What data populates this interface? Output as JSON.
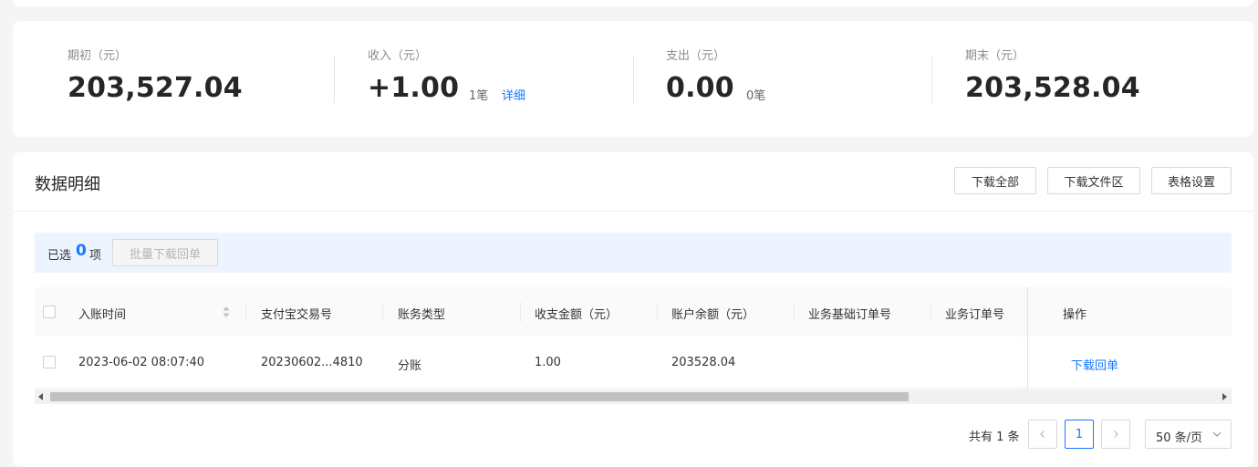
{
  "summary": {
    "opening": {
      "label": "期初（元）",
      "value": "203,527.04"
    },
    "income": {
      "label": "收入（元）",
      "value": "+1.00",
      "count": "1笔",
      "detail_link": "详细"
    },
    "expense": {
      "label": "支出（元）",
      "value": "0.00",
      "count": "0笔"
    },
    "closing": {
      "label": "期末（元）",
      "value": "203,528.04"
    }
  },
  "detail": {
    "title": "数据明细",
    "buttons": {
      "download_all": "下载全部",
      "download_area": "下载文件区",
      "table_settings": "表格设置"
    },
    "selection": {
      "prefix": "已选",
      "count": "0",
      "suffix": "项",
      "bulk_button": "批量下载回单"
    },
    "columns": [
      "入账时间",
      "支付宝交易号",
      "账务类型",
      "收支金额（元）",
      "账户余额（元）",
      "业务基础订单号",
      "业务订单号",
      "操作"
    ],
    "rows": [
      {
        "time": "2023-06-02 08:07:40",
        "trade_no": "20230602...4810",
        "type": "分账",
        "amount": "1.00",
        "balance": "203528.04",
        "base_order": "",
        "order": "",
        "action": "下载回单"
      }
    ],
    "pagination": {
      "total": "共有 1 条",
      "current_page": "1",
      "page_size": "50 条/页"
    }
  }
}
